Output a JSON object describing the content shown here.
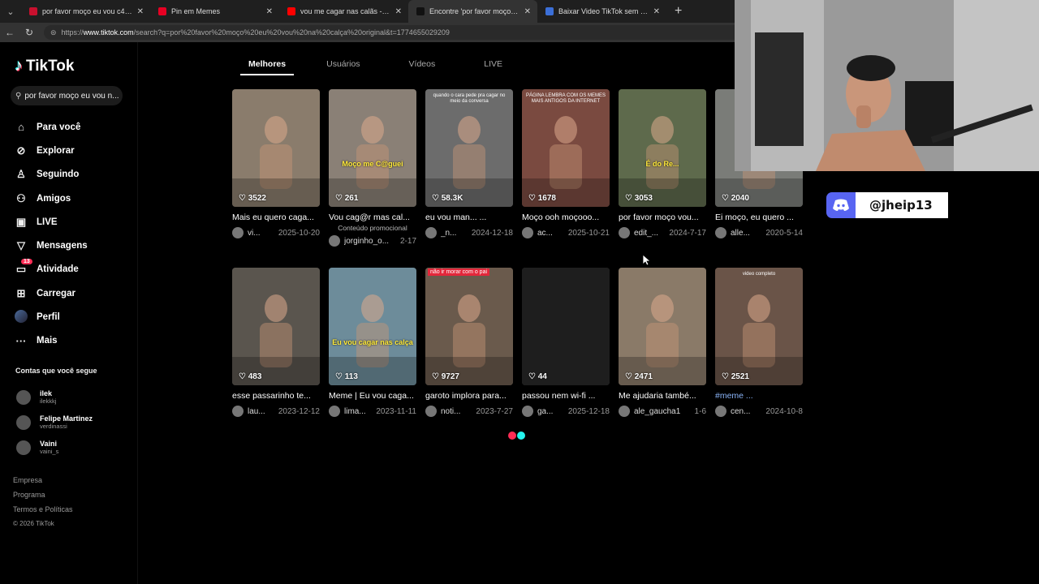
{
  "browser": {
    "tabs": [
      {
        "title": "por favor moço eu vou c4g4r na c",
        "favicon_color": "#c8102e",
        "active": false
      },
      {
        "title": "Pin em Memes",
        "favicon_color": "#e60023",
        "active": false
      },
      {
        "title": "vou me cagar nas calãs - YouTube",
        "favicon_color": "#ff0000",
        "active": false
      },
      {
        "title": "Encontre 'por favor moço eu vou c",
        "favicon_color": "#111111",
        "active": true
      },
      {
        "title": "Baixar Video TikTok sem marca d'á",
        "favicon_color": "#3b6fd8",
        "active": false
      }
    ],
    "url_prefix": "https://",
    "url_host": "www.tiktok.com",
    "url_path": "/search?q=por%20favor%20moço%20eu%20vou%20na%20calça%20original&t=1774655029209"
  },
  "sidebar": {
    "logo": "TikTok",
    "search_value": "por favor moço eu vou n...",
    "nav": [
      {
        "label": "Para você",
        "icon": "home-icon",
        "glyph": "⌂"
      },
      {
        "label": "Explorar",
        "icon": "compass-icon",
        "glyph": "⊘"
      },
      {
        "label": "Seguindo",
        "icon": "following-icon",
        "glyph": "♙"
      },
      {
        "label": "Amigos",
        "icon": "friends-icon",
        "glyph": "⚇"
      },
      {
        "label": "LIVE",
        "icon": "live-icon",
        "glyph": "▣"
      },
      {
        "label": "Mensagens",
        "icon": "messages-icon",
        "glyph": "▽"
      },
      {
        "label": "Atividade",
        "icon": "activity-icon",
        "glyph": "▭",
        "badge": "13"
      },
      {
        "label": "Carregar",
        "icon": "upload-icon",
        "glyph": "⊞"
      },
      {
        "label": "Perfil",
        "icon": "profile-avatar-icon",
        "glyph": ""
      },
      {
        "label": "Mais",
        "icon": "more-icon",
        "glyph": "···"
      }
    ],
    "following_title": "Contas que você segue",
    "following": [
      {
        "name": "ilek",
        "handle": "ilekkkj"
      },
      {
        "name": "Felipe Martinez",
        "handle": "verdinassi"
      },
      {
        "name": "Vaini",
        "handle": "vaini_s"
      }
    ],
    "footer": [
      "Empresa",
      "Programa",
      "Termos e Políticas"
    ],
    "copyright": "© 2026 TikTok"
  },
  "search_tabs": [
    "Melhores",
    "Usuários",
    "Vídeos",
    "LIVE"
  ],
  "results": [
    {
      "likes": "3522",
      "desc": "Mais eu quero caga...",
      "user": "vi...",
      "date": "2025-10-20",
      "thumb": "#8a7c6c"
    },
    {
      "likes": "261",
      "desc": "Vou cag@r mas cal...",
      "promo": "Conteúdo promocional",
      "user": "jorginho_o...",
      "date": "2-17",
      "thumb": "#8a8076",
      "overlay": "Moço me C@guei"
    },
    {
      "likes": "58.3K",
      "desc": "eu vou man... ...",
      "user": "_n...",
      "date": "2024-12-18",
      "thumb": "#6c6c6c",
      "caption": "quando o cara pede pra cagar no meio da conversa"
    },
    {
      "likes": "1678",
      "desc": "Moço ooh moçooo...",
      "user": "ac...",
      "date": "2025-10-21",
      "thumb": "#7a4a40",
      "caption": "PÁGINA LEMBRA COM OS MEMES MAIS ANTIGOS DA INTERNET"
    },
    {
      "likes": "3053",
      "desc": "por favor moço vou...",
      "user": "edit_...",
      "date": "2024-7-17",
      "thumb": "#5e6a4c",
      "overlay": "É do Re..."
    },
    {
      "likes": "2040",
      "desc": "Ei moço, eu quero ...",
      "user": "alle...",
      "date": "2020-5-14",
      "thumb": "#7a7c78"
    },
    {
      "likes": "483",
      "desc": "esse passarinho te...",
      "user": "lau...",
      "date": "2023-12-12",
      "thumb": "#5a554e"
    },
    {
      "likes": "113",
      "desc": "Meme | Eu vou caga...",
      "user": "lima...",
      "date": "2023-11-11",
      "thumb": "#6d8c9a",
      "overlay": "Eu vou cagar nas calça"
    },
    {
      "likes": "9727",
      "desc": "garoto implora para...",
      "user": "noti...",
      "date": "2023-7-27",
      "thumb": "#6a5a4c",
      "label": "não ir morar com o pai"
    },
    {
      "likes": "44",
      "desc": "passou nem wi-fi ...",
      "user": "ga...",
      "date": "2025-12-18",
      "thumb": "#1e1e1e"
    },
    {
      "likes": "2471",
      "desc": "Me ajudaria també...",
      "user": "ale_gaucha1",
      "date": "1-6",
      "thumb": "#8a7a68"
    },
    {
      "likes": "2521",
      "desc": "#meme ...",
      "user": "cen...",
      "date": "2024-10-8",
      "thumb": "#6a5448",
      "caption": "video completo",
      "tag": true
    }
  ],
  "overlay": {
    "discord_handle": "@jheip13"
  },
  "colors": {
    "accent_red": "#fe2c55",
    "accent_cyan": "#25f4ee",
    "discord": "#5865f2"
  }
}
